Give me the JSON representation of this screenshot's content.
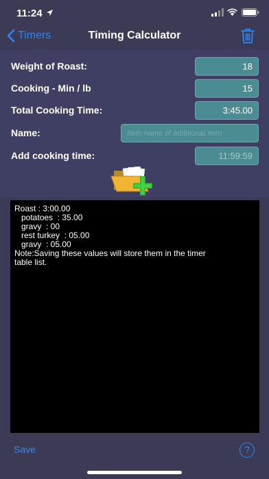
{
  "status": {
    "time": "11:24"
  },
  "nav": {
    "back_label": "Timers",
    "title": "Timing Calculator"
  },
  "form": {
    "weight_label": "Weight of Roast:",
    "weight_value": "18",
    "cooking_label": "Cooking - Min / lb",
    "cooking_value": "15",
    "total_label": "Total Cooking Time:",
    "total_value": "3:45.00",
    "name_label": "Name:",
    "name_placeholder": "Item name of additional item",
    "add_label": "Add cooking time:",
    "add_value": "11:59:59"
  },
  "notes": {
    "lines": [
      "Roast : 3:00.00",
      "   potatoes  : 35.00",
      "   gravy  : 00",
      "   rest turkey  : 05.00",
      "   gravy  : 05.00",
      "",
      "Note:Saving these values will store them in the timer",
      "table list."
    ]
  },
  "bottom": {
    "save_label": "Save",
    "help_label": "?"
  },
  "colors": {
    "accent": "#2f86f6",
    "background": "#3b3b55",
    "field": "#4a8c92"
  },
  "icons": [
    "location-arrow-icon",
    "signal-icon",
    "wifi-icon",
    "battery-icon",
    "chevron-left-icon",
    "trash-icon",
    "folder-add-icon",
    "help-icon"
  ]
}
